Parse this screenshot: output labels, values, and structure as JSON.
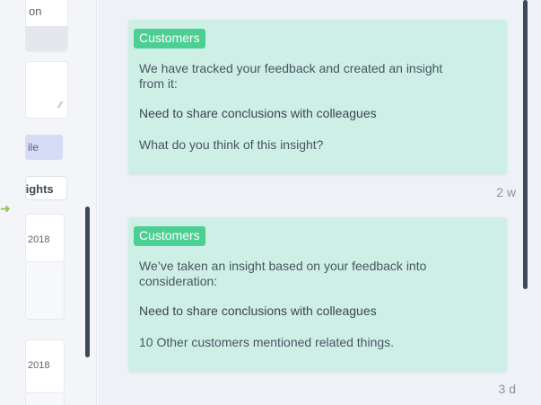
{
  "left_panel": {
    "top_text": "on",
    "chip_label": "ile",
    "tab_label": "lights",
    "item1_date": "2018",
    "item2_date": "2018"
  },
  "feed": {
    "cards": [
      {
        "badge": "Customers",
        "message": "We have tracked your feedback and created an insight from it:",
        "insight": "Need to share conclusions with colleagues",
        "tail": "What do you think of this insight?",
        "time": "2 w"
      },
      {
        "badge": "Customers",
        "message": "We’ve taken an insight based on your feedback into consideration:",
        "insight": "Need to share conclusions with colleagues",
        "tail": "10 Other customers mentioned related things.",
        "time": "3 d"
      }
    ]
  },
  "icons": {
    "arrow": "arrow-right-icon",
    "resize": "resize-handle-icon"
  },
  "colors": {
    "badge": "#4ccf93",
    "card_bg": "#cdefe6",
    "feed_bg": "#eef2f6",
    "arrow": "#8cc24a",
    "scrollbar": "#3f4856"
  }
}
